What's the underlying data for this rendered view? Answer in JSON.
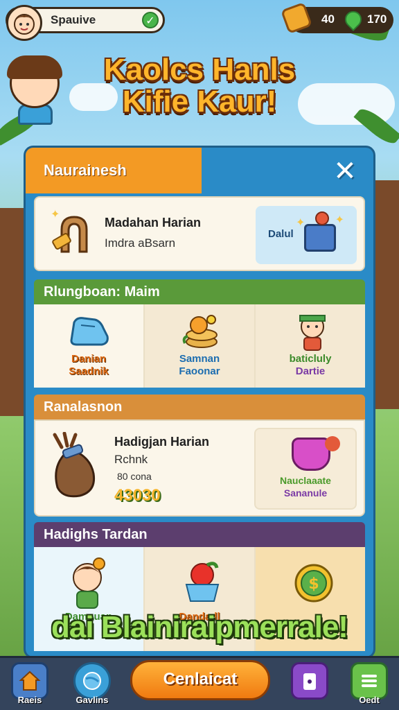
{
  "top_bar": {
    "player_name": "Spauive",
    "currency_a": "40",
    "currency_b": "170"
  },
  "title": "Kaolcs Hanls Kifie Kaur!",
  "panel": {
    "tab_title": "Naurainesh",
    "daily": {
      "title": "Madahan Harian",
      "subtitle": "Imdra aBsarn",
      "preview_label": "Dalul"
    },
    "section_2": {
      "label": "Rlungboan: Maim",
      "tiles": [
        {
          "label_top": "Danian",
          "label_bottom": "Saadnik"
        },
        {
          "label_top": "Samnan",
          "label_bottom": "Faoonar"
        },
        {
          "label_top": "baticluly",
          "label_bottom": "Dartie"
        }
      ]
    },
    "section_3": {
      "label": "Ranalasnon",
      "title": "Hadigjan Harian",
      "subtitle": "Rchnk",
      "note": "80 cona",
      "price": "43030",
      "preview_label_1": "Nauclaaate",
      "preview_label_2": "Sananule"
    },
    "section_4": {
      "label": "Hadighs Tardan",
      "tiles": [
        {
          "label": "Damouan"
        },
        {
          "label": "Dandadl"
        },
        {
          "label": ""
        }
      ]
    }
  },
  "banner": "dai Blainiraipmerrale!",
  "nav": {
    "home_label": "Raeis",
    "explore_label": "Gavlins",
    "cta_label": "Cenlaicat",
    "lock_label": "",
    "menu_label": "Oedt"
  },
  "colors": {
    "panel_blue": "#2a8bc7",
    "tab_orange": "#f39a24",
    "section_green": "#5a9a3a",
    "section_orange": "#d98f3a",
    "section_purple": "#5c3e6e",
    "cta_orange": "#f07a10"
  }
}
